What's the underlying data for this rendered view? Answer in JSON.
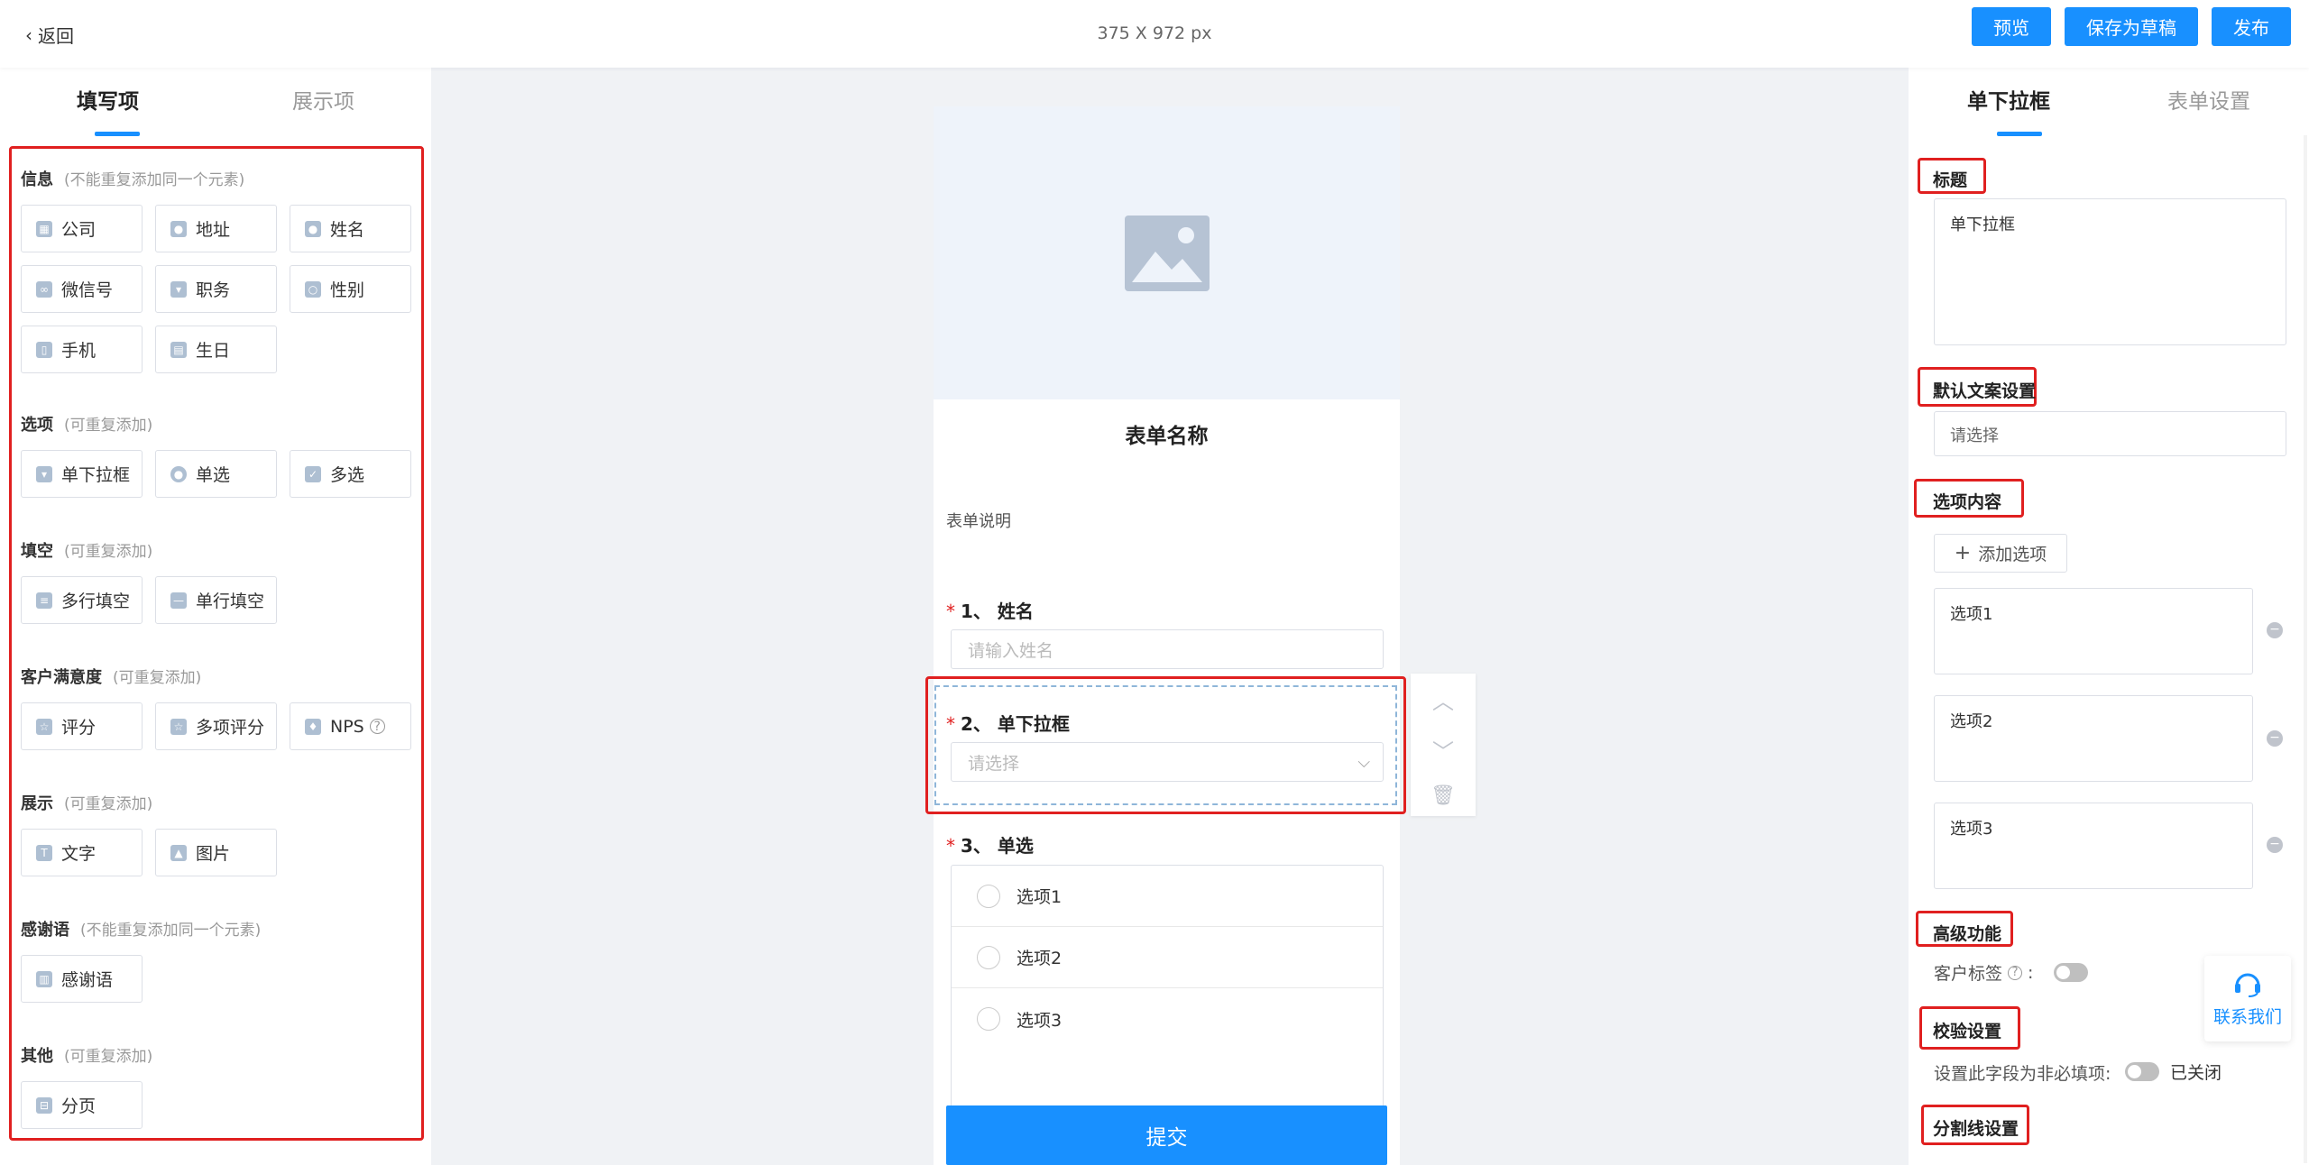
{
  "topbar": {
    "back_label": "返回",
    "dimensions": "375 X 972 px",
    "preview": "预览",
    "save_draft": "保存为草稿",
    "publish": "发布"
  },
  "left": {
    "tabs": [
      "填写项",
      "展示项"
    ],
    "groups": {
      "info": {
        "title": "信息",
        "note": "(不能重复添加同一个元素)",
        "items": [
          "公司",
          "地址",
          "姓名",
          "微信号",
          "职务",
          "性别",
          "手机",
          "生日"
        ]
      },
      "options": {
        "title": "选项",
        "note": "(可重复添加)",
        "items": [
          "单下拉框",
          "单选",
          "多选"
        ]
      },
      "fill": {
        "title": "填空",
        "note": "(可重复添加)",
        "items": [
          "多行填空",
          "单行填空"
        ]
      },
      "satisfaction": {
        "title": "客户满意度",
        "note": "(可重复添加)",
        "items": [
          "评分",
          "多项评分",
          "NPS"
        ]
      },
      "display": {
        "title": "展示",
        "note": "(可重复添加)",
        "items": [
          "文字",
          "图片"
        ]
      },
      "thanks": {
        "title": "感谢语",
        "note": "(不能重复添加同一个元素)",
        "items": [
          "感谢语"
        ]
      },
      "other": {
        "title": "其他",
        "note": "(可重复添加)",
        "items": [
          "分页"
        ]
      }
    }
  },
  "form": {
    "title": "表单名称",
    "description": "表单说明",
    "q1": {
      "label": "1、 姓名",
      "placeholder": "请输入姓名"
    },
    "q2": {
      "label": "2、 单下拉框",
      "placeholder": "请选择"
    },
    "q3": {
      "label": "3、 单选",
      "options": [
        "选项1",
        "选项2",
        "选项3"
      ]
    },
    "submit": "提交"
  },
  "right": {
    "tabs": [
      "单下拉框",
      "表单设置"
    ],
    "title_label": "标题",
    "title_value": "单下拉框",
    "default_text_label": "默认文案设置",
    "default_text_value": "请选择",
    "options_label": "选项内容",
    "add_option": "添加选项",
    "options": [
      "选项1",
      "选项2",
      "选项3"
    ],
    "advanced_label": "高级功能",
    "customer_tag": "客户标签",
    "validation_label": "校验设置",
    "non_required": "设置此字段为非必填项:",
    "non_required_state": "已关闭",
    "divider_label": "分割线设置"
  },
  "contact": "联系我们",
  "colors": {
    "accent": "#1890ff",
    "highlight": "#e02020"
  }
}
